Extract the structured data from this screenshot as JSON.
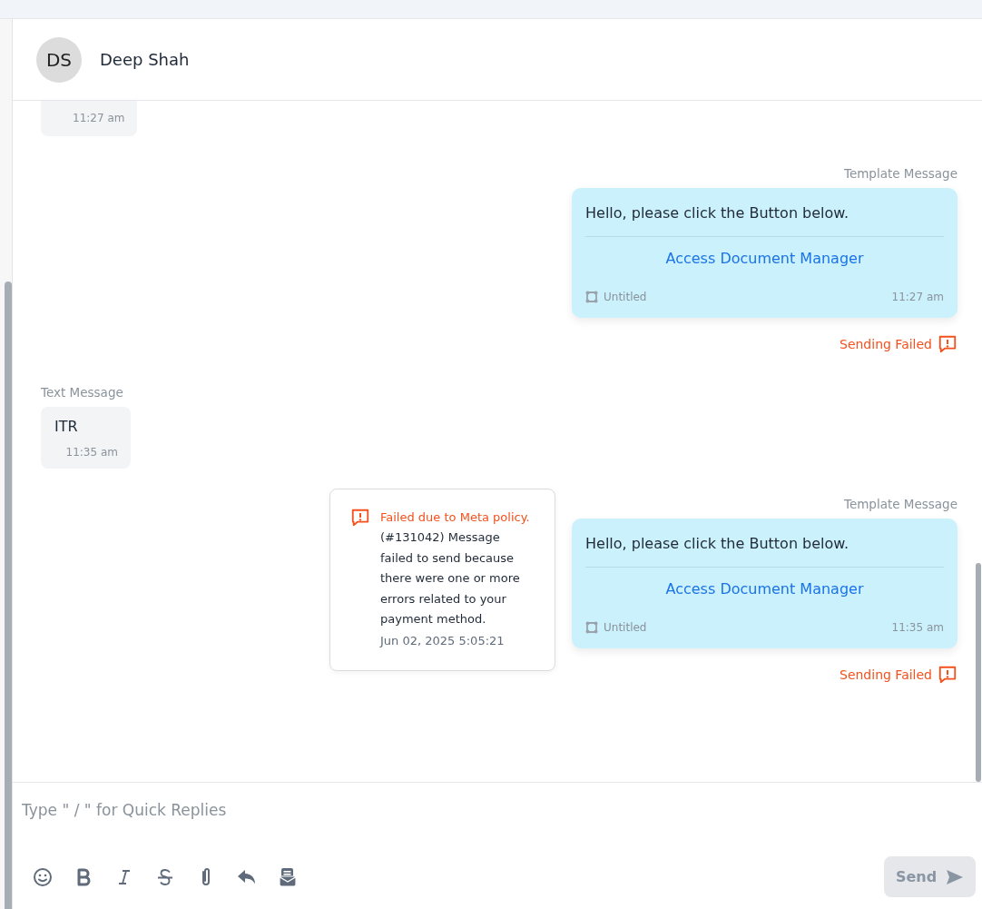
{
  "contact": {
    "initials": "DS",
    "name": "Deep Shah"
  },
  "messages": [
    {
      "kind": "incoming",
      "time": "11:27 am",
      "clipped": true
    },
    {
      "kind": "template",
      "label": "Template Message",
      "text": "Hello, please click the Button below.",
      "button": "Access Document Manager",
      "template_name": "Untitled",
      "time": "11:27 am",
      "status": "Sending Failed",
      "failed": true
    },
    {
      "kind": "incoming",
      "label": "Text Message",
      "text": "ITR",
      "time": "11:35 am",
      "clipped": false
    },
    {
      "kind": "template",
      "label": "Template Message",
      "text": "Hello, please click the Button below.",
      "button": "Access Document Manager",
      "template_name": "Untitled",
      "time": "11:35 am",
      "status": "Sending Failed",
      "failed": true,
      "error": {
        "title": "Failed due to Meta policy.",
        "text": "(#131042) Message failed to send because there were one or more errors related to your payment method.",
        "time": "Jun 02, 2025 5:05:21"
      }
    }
  ],
  "composer": {
    "placeholder": "Type \" / \" for Quick Replies",
    "tools": [
      {
        "kind": "emoji"
      },
      {
        "kind": "bold"
      },
      {
        "kind": "italic"
      },
      {
        "kind": "strikethrough"
      },
      {
        "kind": "attachment"
      },
      {
        "kind": "reply"
      },
      {
        "kind": "template"
      }
    ],
    "send": {
      "label": "Send",
      "disabled": true
    }
  }
}
